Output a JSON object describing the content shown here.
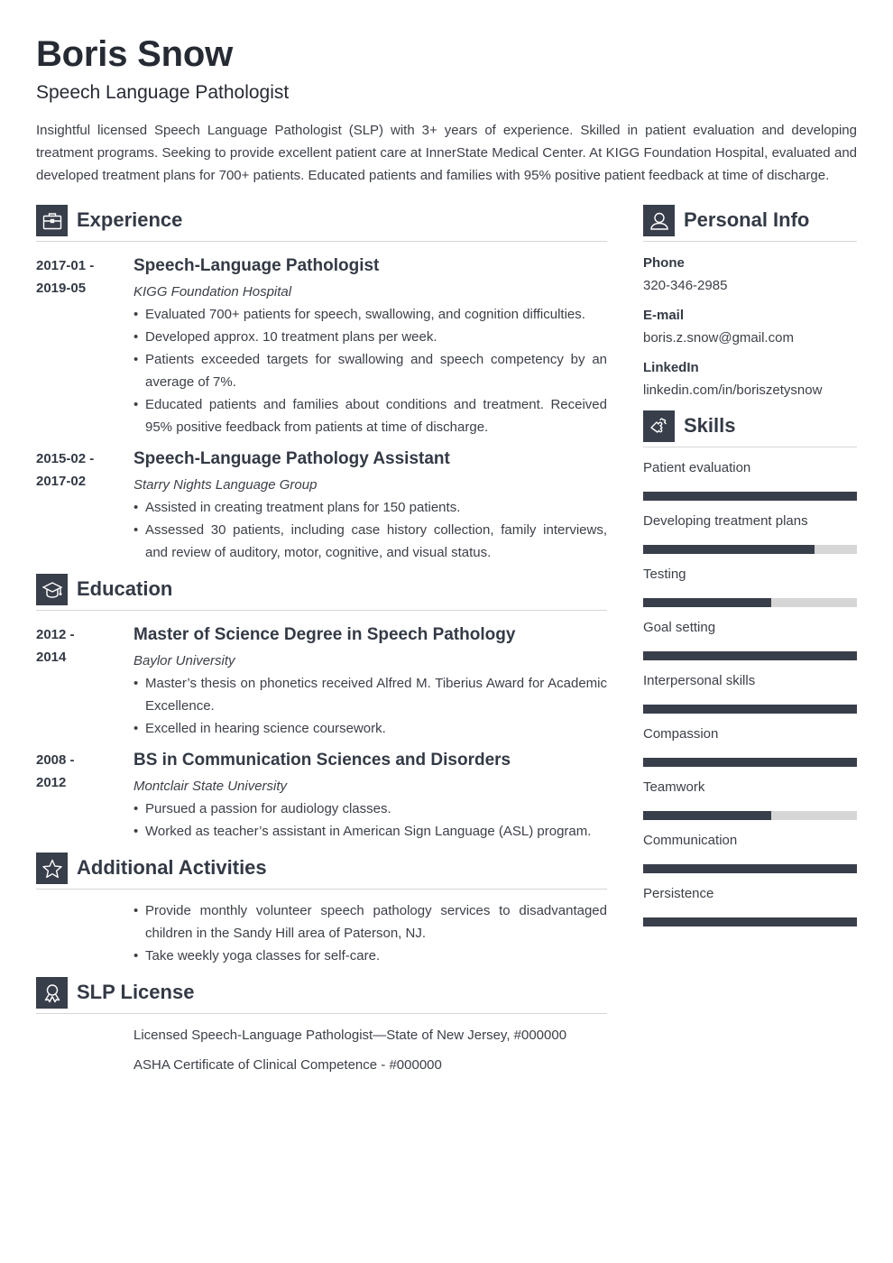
{
  "header": {
    "name": "Boris Snow",
    "title": "Speech Language Pathologist",
    "summary": "Insightful licensed Speech Language Pathologist (SLP) with 3+ years of experience. Skilled in patient evaluation and developing treatment programs. Seeking to provide excellent patient care at InnerState Medical Center. At KIGG Foundation Hospital, evaluated and developed treatment plans for 700+ patients. Educated patients and families with 95% positive patient feedback at time of discharge."
  },
  "experience": {
    "heading": "Experience",
    "icon": "briefcase-icon",
    "entries": [
      {
        "date_start": "2017-01 -",
        "date_end": "2019-05",
        "role": "Speech-Language Pathologist",
        "org": "KIGG Foundation Hospital",
        "bullets": [
          "Evaluated 700+ patients for speech, swallowing, and cognition difficulties.",
          "Developed approx. 10 treatment plans per week.",
          "Patients exceeded targets for swallowing and speech competency by an average of 7%.",
          "Educated patients and families about conditions and treatment. Received 95% positive feedback from patients at time of discharge."
        ]
      },
      {
        "date_start": "2015-02 -",
        "date_end": "2017-02",
        "role": "Speech-Language Pathology Assistant",
        "org": "Starry Nights Language Group",
        "bullets": [
          "Assisted in creating treatment plans for 150 patients.",
          "Assessed 30 patients, including case history collection, family interviews, and review of auditory, motor, cognitive, and visual status."
        ]
      }
    ]
  },
  "education": {
    "heading": "Education",
    "icon": "graduation-cap-icon",
    "entries": [
      {
        "date_start": "2012 -",
        "date_end": "2014",
        "role": "Master of Science Degree in Speech Pathology",
        "org": "Baylor University",
        "bullets": [
          "Master’s thesis on phonetics received Alfred M. Tiberius Award for Academic Excellence.",
          "Excelled in hearing science coursework."
        ]
      },
      {
        "date_start": "2008 -",
        "date_end": "2012",
        "role": "BS in Communication Sciences and Disorders",
        "org": "Montclair State University",
        "bullets": [
          "Pursued a passion for audiology classes.",
          "Worked as teacher’s assistant in American Sign Language (ASL) program."
        ]
      }
    ]
  },
  "activities": {
    "heading": "Additional Activities",
    "icon": "star-icon",
    "bullets": [
      "Provide monthly volunteer speech pathology services to disadvantaged children in the Sandy Hill area of Paterson, NJ.",
      "Take weekly yoga classes for self-care."
    ]
  },
  "license": {
    "heading": "SLP License",
    "icon": "award-ribbon-icon",
    "items": [
      "Licensed Speech-Language Pathologist—State of New Jersey, #000000",
      "ASHA Certificate of Clinical Competence - #000000"
    ]
  },
  "personal": {
    "heading": "Personal Info",
    "icon": "user-icon",
    "fields": [
      {
        "label": "Phone",
        "value": "320-346-2985"
      },
      {
        "label": "E-mail",
        "value": "boris.z.snow@gmail.com"
      },
      {
        "label": "LinkedIn",
        "value": "linkedin.com/in/boriszetysnow"
      }
    ]
  },
  "skills": {
    "heading": "Skills",
    "icon": "puzzle-piece-icon",
    "items": [
      {
        "name": "Patient evaluation",
        "level": 1.0
      },
      {
        "name": "Developing treatment plans",
        "level": 0.8
      },
      {
        "name": "Testing",
        "level": 0.6
      },
      {
        "name": "Goal setting",
        "level": 1.0
      },
      {
        "name": "Interpersonal skills",
        "level": 1.0
      },
      {
        "name": "Compassion",
        "level": 1.0
      },
      {
        "name": "Teamwork",
        "level": 0.6
      },
      {
        "name": "Communication",
        "level": 1.0
      },
      {
        "name": "Persistence",
        "level": 1.0
      }
    ]
  },
  "colors": {
    "accent": "#383e4a",
    "bar_track": "#d5d6d5",
    "text": "#333a45"
  }
}
